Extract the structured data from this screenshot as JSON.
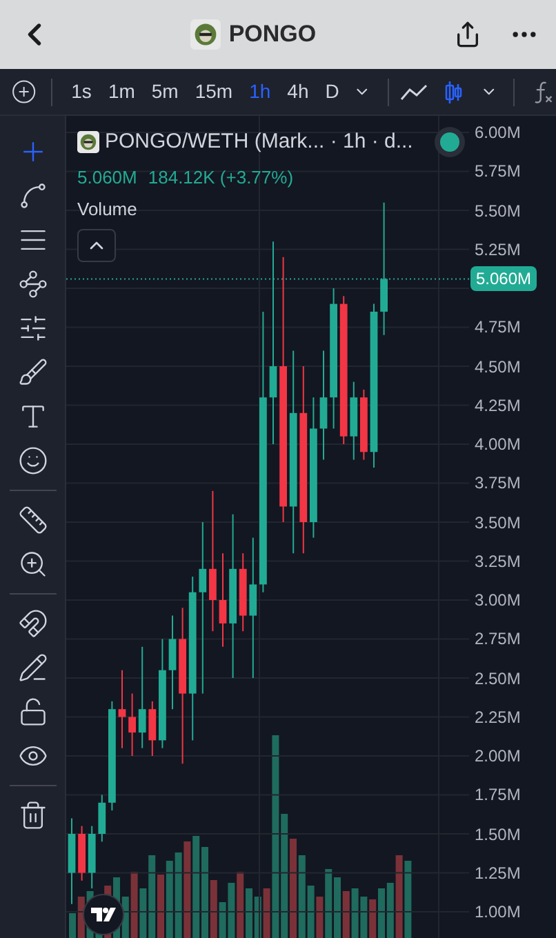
{
  "header": {
    "title": "PONGO"
  },
  "toolbar": {
    "intervals": [
      {
        "label": "1s",
        "selected": false
      },
      {
        "label": "1m",
        "selected": false
      },
      {
        "label": "5m",
        "selected": false
      },
      {
        "label": "15m",
        "selected": false
      },
      {
        "label": "1h",
        "selected": true
      },
      {
        "label": "4h",
        "selected": false
      },
      {
        "label": "D",
        "selected": false
      }
    ],
    "chart_styles": [
      {
        "kind": "line",
        "selected": false
      },
      {
        "kind": "candles",
        "selected": true
      }
    ]
  },
  "tool_groups": [
    [
      {
        "selected": true
      },
      {
        "selected": false
      },
      {
        "selected": false
      },
      {
        "selected": false
      },
      {
        "selected": false
      },
      {
        "selected": false
      },
      {
        "selected": false
      },
      {
        "selected": false
      }
    ],
    [
      {
        "selected": false
      },
      {
        "selected": false
      }
    ],
    [
      {
        "selected": false
      },
      {
        "selected": false
      },
      {
        "selected": false
      },
      {
        "selected": false
      }
    ],
    [
      {
        "selected": false
      }
    ]
  ],
  "chart_data": {
    "type": "candlestick",
    "grid": true,
    "ref_lines": [
      {
        "axis": "y",
        "value": 5.06
      }
    ],
    "ylim": [
      1.0,
      6.0
    ],
    "yticks": [
      {
        "value": 6.0,
        "label": "6.00M"
      },
      {
        "value": 5.75,
        "label": "5.75M"
      },
      {
        "value": 5.5,
        "label": "5.50M"
      },
      {
        "value": 5.25,
        "label": "5.25M"
      },
      {
        "value": 4.75,
        "label": "4.75M"
      },
      {
        "value": 4.5,
        "label": "4.50M"
      },
      {
        "value": 4.25,
        "label": "4.25M"
      },
      {
        "value": 4.0,
        "label": "4.00M"
      },
      {
        "value": 3.75,
        "label": "3.75M"
      },
      {
        "value": 3.5,
        "label": "3.50M"
      },
      {
        "value": 3.25,
        "label": "3.25M"
      },
      {
        "value": 3.0,
        "label": "3.00M"
      },
      {
        "value": 2.75,
        "label": "2.75M"
      },
      {
        "value": 2.5,
        "label": "2.50M"
      },
      {
        "value": 2.25,
        "label": "2.25M"
      },
      {
        "value": 2.0,
        "label": "2.00M"
      },
      {
        "value": 1.75,
        "label": "1.75M"
      },
      {
        "value": 1.5,
        "label": "1.50M"
      },
      {
        "value": 1.25,
        "label": "1.25M"
      },
      {
        "value": 1.0,
        "label": "1.00M"
      }
    ],
    "ohlc": [
      [
        1.25,
        1.6,
        1.05,
        1.5
      ],
      [
        1.5,
        1.55,
        1.2,
        1.25
      ],
      [
        1.25,
        1.55,
        1.15,
        1.5
      ],
      [
        1.5,
        1.75,
        1.45,
        1.7
      ],
      [
        1.7,
        2.35,
        1.65,
        2.3
      ],
      [
        2.3,
        2.55,
        2.05,
        2.25
      ],
      [
        2.25,
        2.4,
        2.0,
        2.15
      ],
      [
        2.15,
        2.7,
        2.05,
        2.3
      ],
      [
        2.3,
        2.35,
        2.0,
        2.1
      ],
      [
        2.1,
        2.75,
        2.05,
        2.55
      ],
      [
        2.55,
        2.9,
        2.3,
        2.75
      ],
      [
        2.75,
        2.95,
        1.95,
        2.4
      ],
      [
        2.4,
        3.15,
        2.1,
        3.05
      ],
      [
        3.05,
        3.5,
        2.4,
        3.2
      ],
      [
        3.2,
        3.7,
        2.8,
        3.0
      ],
      [
        3.0,
        3.3,
        2.7,
        2.85
      ],
      [
        2.85,
        3.55,
        2.5,
        3.2
      ],
      [
        3.2,
        3.3,
        2.8,
        2.9
      ],
      [
        2.9,
        3.4,
        2.5,
        3.1
      ],
      [
        3.1,
        4.85,
        3.05,
        4.3
      ],
      [
        4.3,
        5.3,
        4.0,
        4.5
      ],
      [
        4.5,
        5.2,
        3.5,
        3.6
      ],
      [
        3.6,
        4.6,
        3.3,
        4.2
      ],
      [
        4.2,
        4.5,
        3.3,
        3.5
      ],
      [
        3.5,
        4.3,
        3.4,
        4.1
      ],
      [
        4.1,
        4.6,
        3.9,
        4.3
      ],
      [
        4.3,
        5.0,
        4.1,
        4.9
      ],
      [
        4.9,
        4.95,
        4.0,
        4.05
      ],
      [
        4.05,
        4.4,
        3.9,
        4.3
      ],
      [
        4.3,
        4.35,
        3.9,
        3.95
      ],
      [
        3.95,
        4.9,
        3.85,
        4.85
      ],
      [
        4.85,
        5.55,
        4.7,
        5.06
      ]
    ]
  },
  "legend": {
    "symbol": "PONGO/WETH (Mark... · 1h · d...",
    "live": true,
    "price": "5.060M",
    "change": "184.12K (+3.77%)",
    "study": "Volume"
  },
  "price_axis": {
    "current_price": "5.060M"
  }
}
